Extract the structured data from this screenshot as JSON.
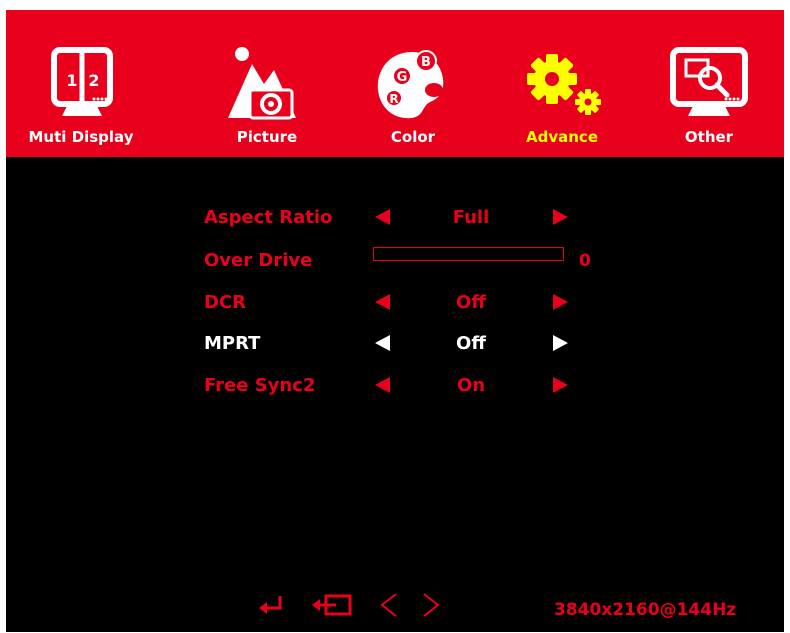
{
  "colors": {
    "accent": "#e8001c",
    "active_tab": "#ffff00",
    "selected_item": "#ffffff",
    "background": "#000000"
  },
  "tabs": [
    {
      "label": "Muti Display",
      "icon": "multi-display-icon"
    },
    {
      "label": "Picture",
      "icon": "picture-camera-icon"
    },
    {
      "label": "Color",
      "icon": "color-palette-icon"
    },
    {
      "label": "Advance",
      "icon": "gears-icon",
      "active": true
    },
    {
      "label": "Other",
      "icon": "monitor-search-icon"
    }
  ],
  "multi_display_icon_text": [
    "1",
    "2"
  ],
  "color_icon_text": [
    "B",
    "G",
    "R"
  ],
  "settings": [
    {
      "label": "Aspect Ratio",
      "value": "Full"
    },
    {
      "label": "Over Drive",
      "value": "0",
      "type": "slider",
      "level": 0
    },
    {
      "label": "DCR",
      "value": "Off"
    },
    {
      "label": "MPRT",
      "value": "Off",
      "selected": true
    },
    {
      "label": "Free Sync2",
      "value": "On"
    }
  ],
  "nav_keys": [
    "enter-icon",
    "exit-icon",
    "left-icon",
    "right-icon"
  ],
  "resolution": "3840x2160@144Hz"
}
